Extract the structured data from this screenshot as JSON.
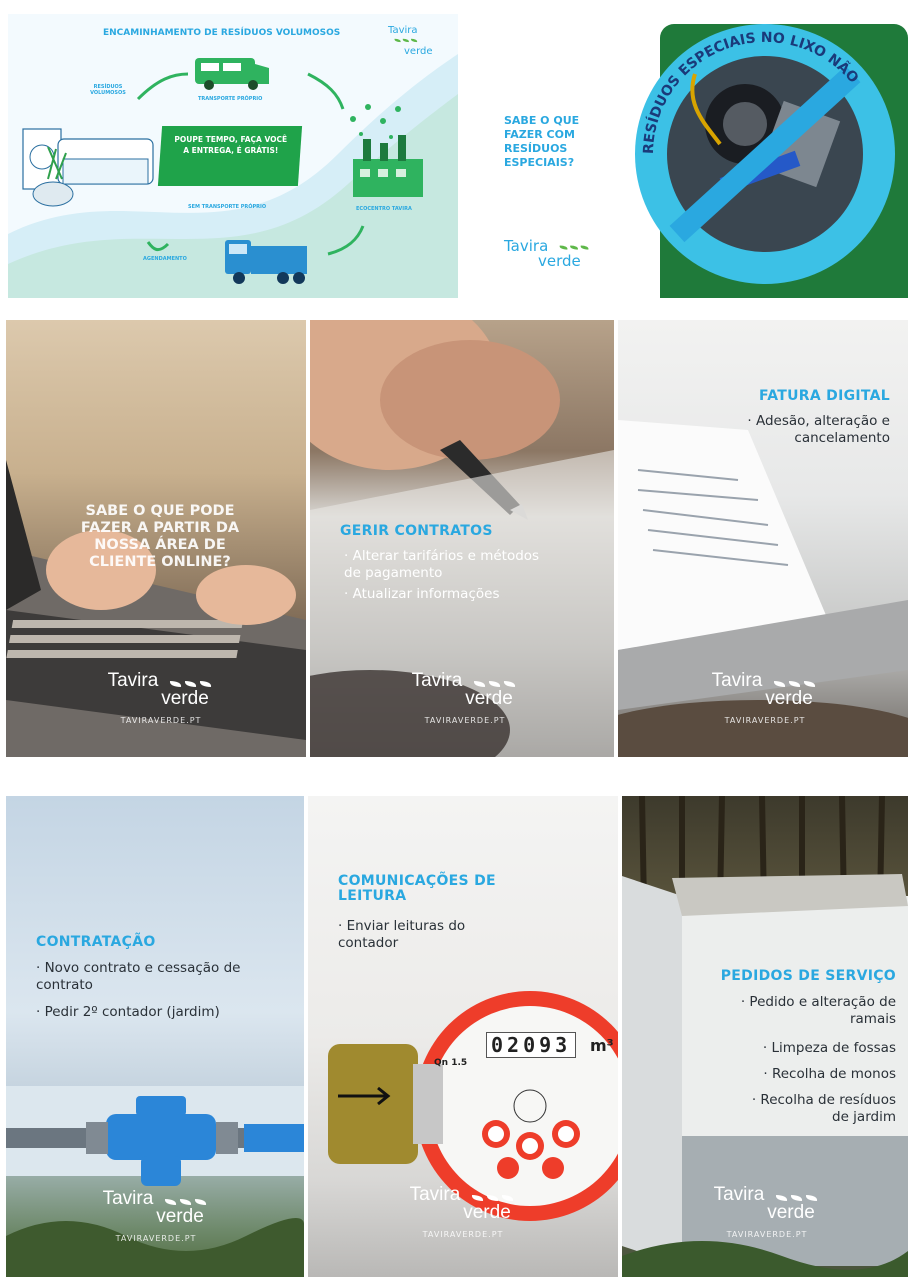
{
  "tile1": {
    "title": "ENCAMINHAMENTO DE RESÍDUOS VOLUMOSOS",
    "brand_tavira": "Tavira",
    "brand_verde": "verde",
    "step_monos": "RESÍDUOS VOLUMOSOS",
    "step_transport": "TRANSPORTE PRÓPRIO",
    "cta_text": "POUPE TEMPO, FAÇA VOCÊ A ENTREGA, É GRÁTIS!",
    "step_pickup": "SEM TRANSPORTE PRÓPRIO",
    "step_scheduling": "AGENDAMENTO",
    "step_ecocentro": "ECOCENTRO TAVIRA"
  },
  "tile2": {
    "question": "SABE O QUE FAZER COM RESÍDUOS ESPECIAIS?",
    "brand_tavira": "Tavira",
    "brand_verde": "verde",
    "ring_text": "RESÍDUOS ESPECIAIS NO LIXO NÃO"
  },
  "tile3": {
    "text": "SABE O QUE PODE FAZER A PARTIR DA NOSSA ÁREA DE CLIENTE ONLINE?",
    "brand_tavira": "Tavira",
    "brand_verde": "verde",
    "url": "TAVIRAVERDE.PT"
  },
  "tile4": {
    "heading": "GERIR CONTRATOS",
    "items": [
      "· Alterar tarifários e métodos de pagamento",
      "· Atualizar informações"
    ],
    "brand_tavira": "Tavira",
    "brand_verde": "verde",
    "url": "TAVIRAVERDE.PT"
  },
  "tile5": {
    "heading": "FATURA DIGITAL",
    "items": [
      "· Adesão, alteração e cancelamento"
    ],
    "brand_tavira": "Tavira",
    "brand_verde": "verde",
    "url": "TAVIRAVERDE.PT"
  },
  "tile6": {
    "heading": "CONTRATAÇÃO",
    "items": [
      "· Novo contrato e cessação de contrato",
      "· Pedir 2º contador (jardim)"
    ],
    "brand_tavira": "Tavira",
    "brand_verde": "verde",
    "url": "TAVIRAVERDE.PT"
  },
  "tile7": {
    "heading": "COMUNICAÇÕES DE LEITURA",
    "items": [
      "· Enviar leituras do contador"
    ],
    "meter_reading": "02093",
    "meter_unit": "m³",
    "meter_qn": "Qn 1.5",
    "brand_tavira": "Tavira",
    "brand_verde": "verde",
    "url": "TAVIRAVERDE.PT"
  },
  "tile8": {
    "heading": "PEDIDOS DE SERVIÇO",
    "items": [
      "· Pedido e alteração de ramais",
      "· Limpeza de fossas",
      "· Recolha de monos",
      "· Recolha de resíduos de jardim"
    ],
    "brand_tavira": "Tavira",
    "brand_verde": "verde",
    "url": "TAVIRAVERDE.PT"
  },
  "colors": {
    "accent_blue": "#2aa8e0",
    "brand_green": "#1fa34a",
    "dark_blue": "#1a3a7a"
  }
}
